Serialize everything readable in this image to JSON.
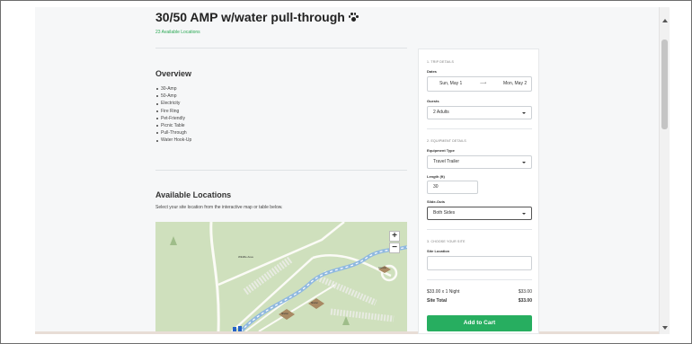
{
  "header": {
    "title": "30/50 AMP w/water pull-through",
    "subtitle": "23 Available Locations",
    "title_icon": "paw-icon"
  },
  "overview": {
    "heading": "Overview",
    "amenities": [
      "30-Amp",
      "50-Amp",
      "Electricity",
      "Fire Ring",
      "Pet-Friendly",
      "Picnic Table",
      "Pull-Through",
      "Water Hook-Up"
    ]
  },
  "locations": {
    "heading": "Available Locations",
    "description": "Select your site location from the interactive map or table below.",
    "map": {
      "zoom_in_label": "+",
      "zoom_out_label": "−",
      "area_label": "Wildlife Area",
      "site_labels": [
        "Gazebo",
        "Shelter",
        "Shelter",
        "Shelter"
      ]
    }
  },
  "sidebar": {
    "trip": {
      "section_label": "1. TRIP DETAILS",
      "dates_label": "Dates",
      "date_start": "Sun, May 1",
      "date_arrow": "⟶",
      "date_end": "Mon, May 2",
      "guests_label": "Guests",
      "guests_value": "2 Adults"
    },
    "equipment": {
      "section_label": "2. EQUIPMENT DETAILS",
      "type_label": "Equipment Type",
      "type_value": "Travel Trailer",
      "length_label": "Length (ft)",
      "length_value": "30",
      "slideouts_label": "Slide-Outs",
      "slideouts_value": "Both Sides"
    },
    "site": {
      "section_label": "3. CHOOSE YOUR SITE",
      "location_label": "Site Location",
      "location_value": ""
    },
    "pricing": {
      "line_label": "$33.00 x 1 Night",
      "line_value": "$33.00",
      "total_label": "Site Total",
      "total_value": "$33.00"
    },
    "cart_button": "Add to Cart"
  },
  "colors": {
    "accent_green": "#27ae60",
    "subtitle_green": "#2aa853",
    "map_bg": "#cfe0bd"
  }
}
